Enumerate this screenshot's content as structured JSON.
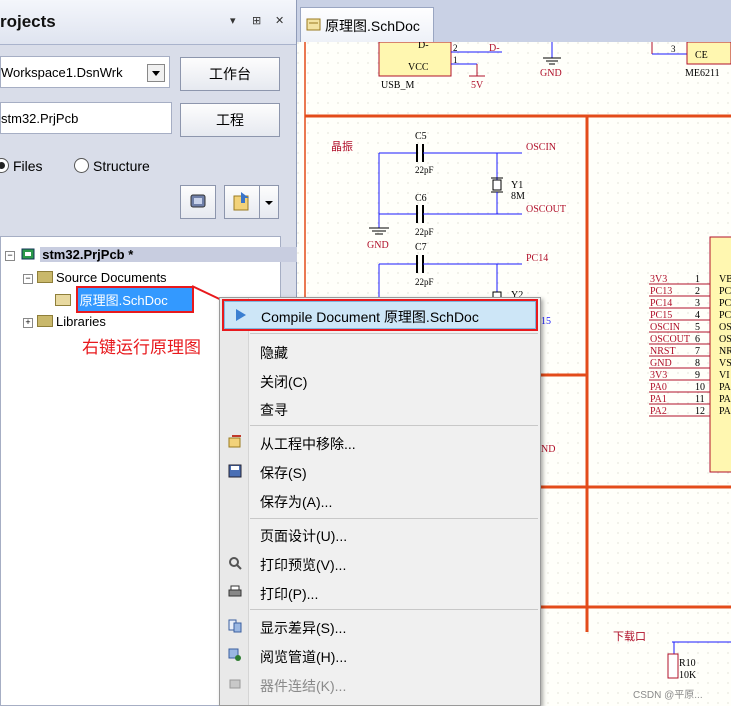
{
  "panel": {
    "title": "rojects",
    "header_controls": [
      "▾",
      "⊞",
      "✕"
    ],
    "workspace_value": "Workspace1.DsnWrk",
    "workspace_button": "工作台",
    "project_value": "stm32.PrjPcb",
    "project_button": "工程",
    "view_options": [
      "Files",
      "Structure"
    ],
    "tree": {
      "project": "stm32.PrjPcb *",
      "source_folder": "Source Documents",
      "document": "原理图.SchDoc",
      "libraries": "Libraries"
    }
  },
  "document_tab": "原理图.SchDoc",
  "annotation": "右键运行原理图",
  "context_menu": {
    "items": [
      {
        "label": "Compile Document 原理图.SchDoc",
        "enabled": true,
        "highlighted": true
      },
      {
        "label": "隐藏",
        "enabled": true
      },
      {
        "label": "关闭(C)",
        "enabled": true
      },
      {
        "label": "查寻",
        "enabled": true
      },
      {
        "label": "从工程中移除...",
        "enabled": true
      },
      {
        "label": "保存(S)",
        "enabled": true
      },
      {
        "label": "保存为(A)...",
        "enabled": true
      },
      {
        "label": "页面设计(U)...",
        "enabled": true
      },
      {
        "label": "打印预览(V)...",
        "enabled": true
      },
      {
        "label": "打印(P)...",
        "enabled": true
      },
      {
        "label": "显示差异(S)...",
        "enabled": true
      },
      {
        "label": "阅览管道(H)...",
        "enabled": true
      },
      {
        "label": "器件连结(K)...",
        "enabled": false
      }
    ]
  },
  "schematic": {
    "labels": {
      "usb_pin": "D-",
      "vcc": "VCC",
      "pin2": "2",
      "pin1": "1",
      "dminus": "D-",
      "usb_m": "USB_M",
      "v5": "5V",
      "gnd_top": "GND",
      "pin3": "3",
      "ce": "CE",
      "me6211": "ME6211",
      "crystal_section": "晶振",
      "c5": "C5",
      "c6": "C6",
      "c7": "C7",
      "cap_a": "22pF",
      "cap_b": "22pF",
      "cap_c": "22pF",
      "oscin": "OSCIN",
      "oscout": "OSCOUT",
      "y1": "Y1",
      "y1_freq": "8M",
      "y2": "Y2",
      "pc14_net": "PC14",
      "pin15": "15",
      "gnd_left": "GND",
      "gnd_mid": "ND",
      "download_section": "下载口",
      "r10": "R10",
      "r10_val": "10K",
      "watermark": "CSDN @平原..."
    },
    "mcu_nets": [
      "3V3",
      "PC13",
      "PC14",
      "PC15",
      "OSCIN",
      "OSCOUT",
      "NRST",
      "GND",
      "3V3",
      "PA0",
      "PA1",
      "PA2"
    ],
    "mcu_pins": [
      "1",
      "2",
      "3",
      "4",
      "5",
      "6",
      "7",
      "8",
      "9",
      "10",
      "11",
      "12"
    ],
    "mcu_pin_names": [
      "VB",
      "PC",
      "PC",
      "PC",
      "OS",
      "OS",
      "NR",
      "VS",
      "VI",
      "PA",
      "PA",
      "PA"
    ]
  },
  "colors": {
    "wire": "#1b1bff",
    "border": "#e34b1a",
    "net_text": "#b0102a",
    "menu_highlight": "#cde6f7",
    "tree_selection": "#3399ff",
    "annotation": "#e8191d"
  }
}
